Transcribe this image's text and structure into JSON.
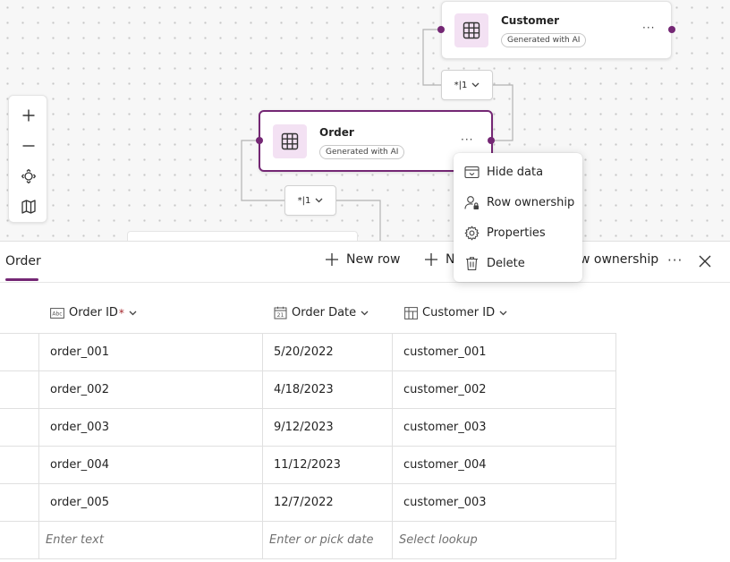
{
  "canvas": {
    "customer_entity": {
      "title": "Customer",
      "badge": "Generated with AI",
      "more": "···"
    },
    "order_entity": {
      "title": "Order",
      "badge": "Generated with AI",
      "more": "···"
    },
    "relation_top": {
      "label": "*|1"
    },
    "relation_bottom": {
      "label": "*|1"
    }
  },
  "context_menu": {
    "items": [
      {
        "label": "Hide data",
        "icon": "hide-data-icon"
      },
      {
        "label": "Row ownership",
        "icon": "row-ownership-icon"
      },
      {
        "label": "Properties",
        "icon": "gear-icon"
      },
      {
        "label": "Delete",
        "icon": "trash-icon"
      }
    ]
  },
  "panel": {
    "tab": "Order",
    "toolbar": {
      "new_row": "New row",
      "new_column_partial": "N",
      "row_ownership_partial": "w ownership",
      "more": "···"
    },
    "table": {
      "columns": [
        {
          "label": "Order ID",
          "required": "*",
          "icon": "text-type-icon"
        },
        {
          "label": "Order Date",
          "icon": "calendar-icon"
        },
        {
          "label": "Customer ID",
          "icon": "lookup-icon"
        }
      ],
      "rows": [
        [
          "order_001",
          "5/20/2022",
          "customer_001"
        ],
        [
          "order_002",
          "4/18/2023",
          "customer_002"
        ],
        [
          "order_003",
          "9/12/2023",
          "customer_003"
        ],
        [
          "order_004",
          "11/12/2023",
          "customer_004"
        ],
        [
          "order_005",
          "12/7/2022",
          "customer_003"
        ]
      ],
      "placeholders": [
        "Enter text",
        "Enter or pick date",
        "Select lookup"
      ]
    }
  },
  "colors": {
    "accent": "#742774",
    "icon_bg": "#f3e1f3"
  }
}
